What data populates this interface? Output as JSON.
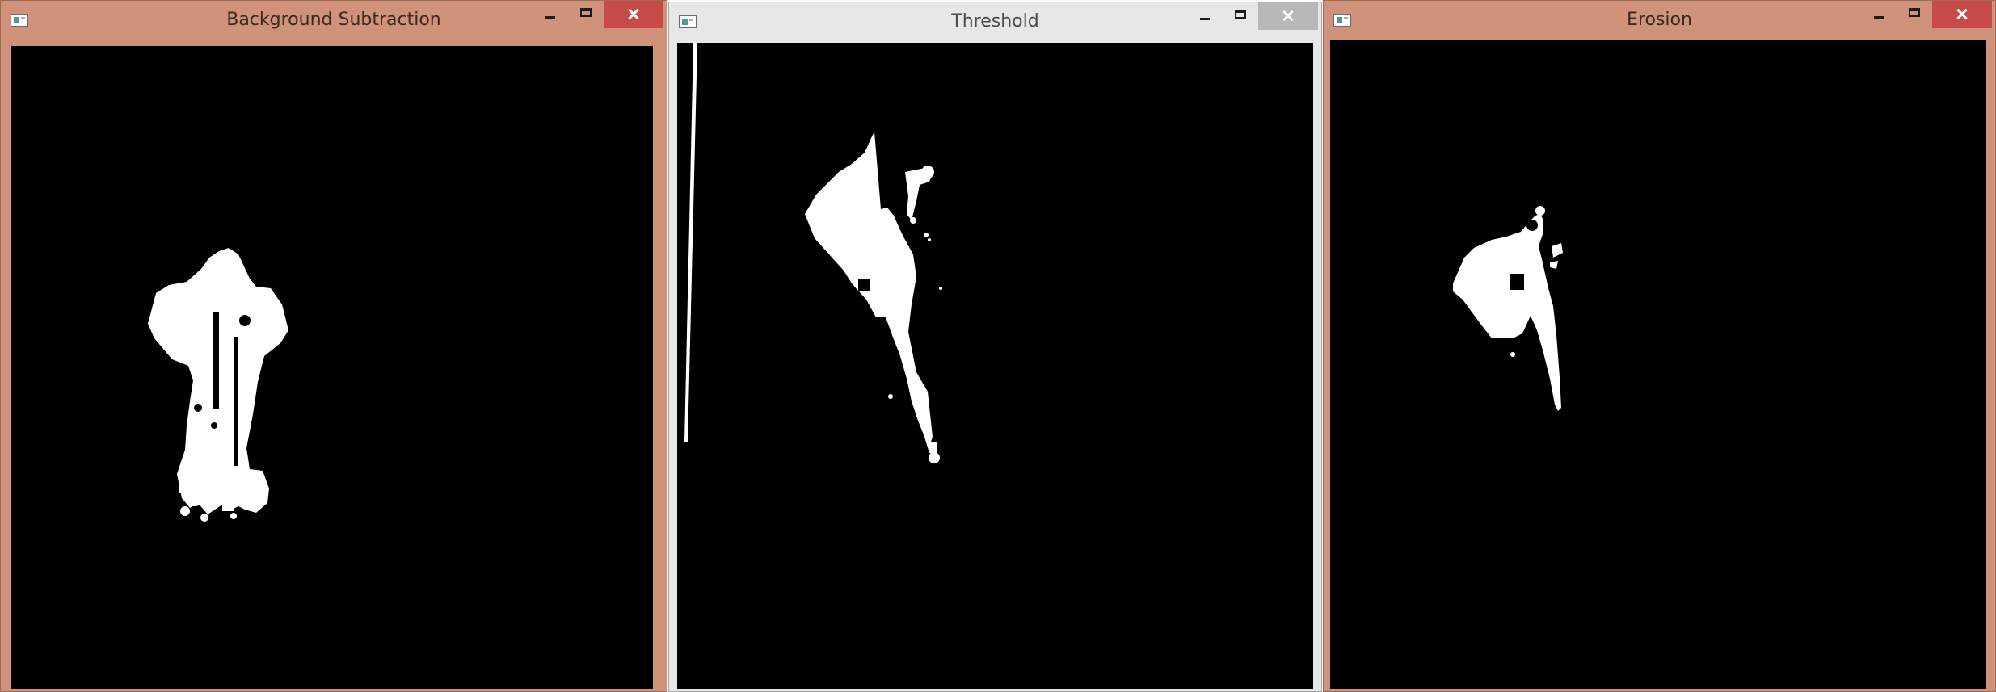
{
  "windows": [
    {
      "title": "Background Subtraction",
      "state": "active",
      "frame_color": "#d0927a"
    },
    {
      "title": "Threshold",
      "state": "inactive",
      "frame_color": "#e7e7e7"
    },
    {
      "title": "Erosion",
      "state": "active",
      "frame_color": "#d0927a"
    }
  ],
  "icons": {
    "app": "opencv-window-icon",
    "minimize": "minimize-icon",
    "maximize": "maximize-icon",
    "close": "close-icon"
  },
  "colors": {
    "active_frame": "#d0927a",
    "inactive_frame": "#e7e7e7",
    "close_active": "#c74a46",
    "close_inactive": "#b8b8b8",
    "mask_background": "#000000",
    "mask_foreground": "#ffffff"
  }
}
